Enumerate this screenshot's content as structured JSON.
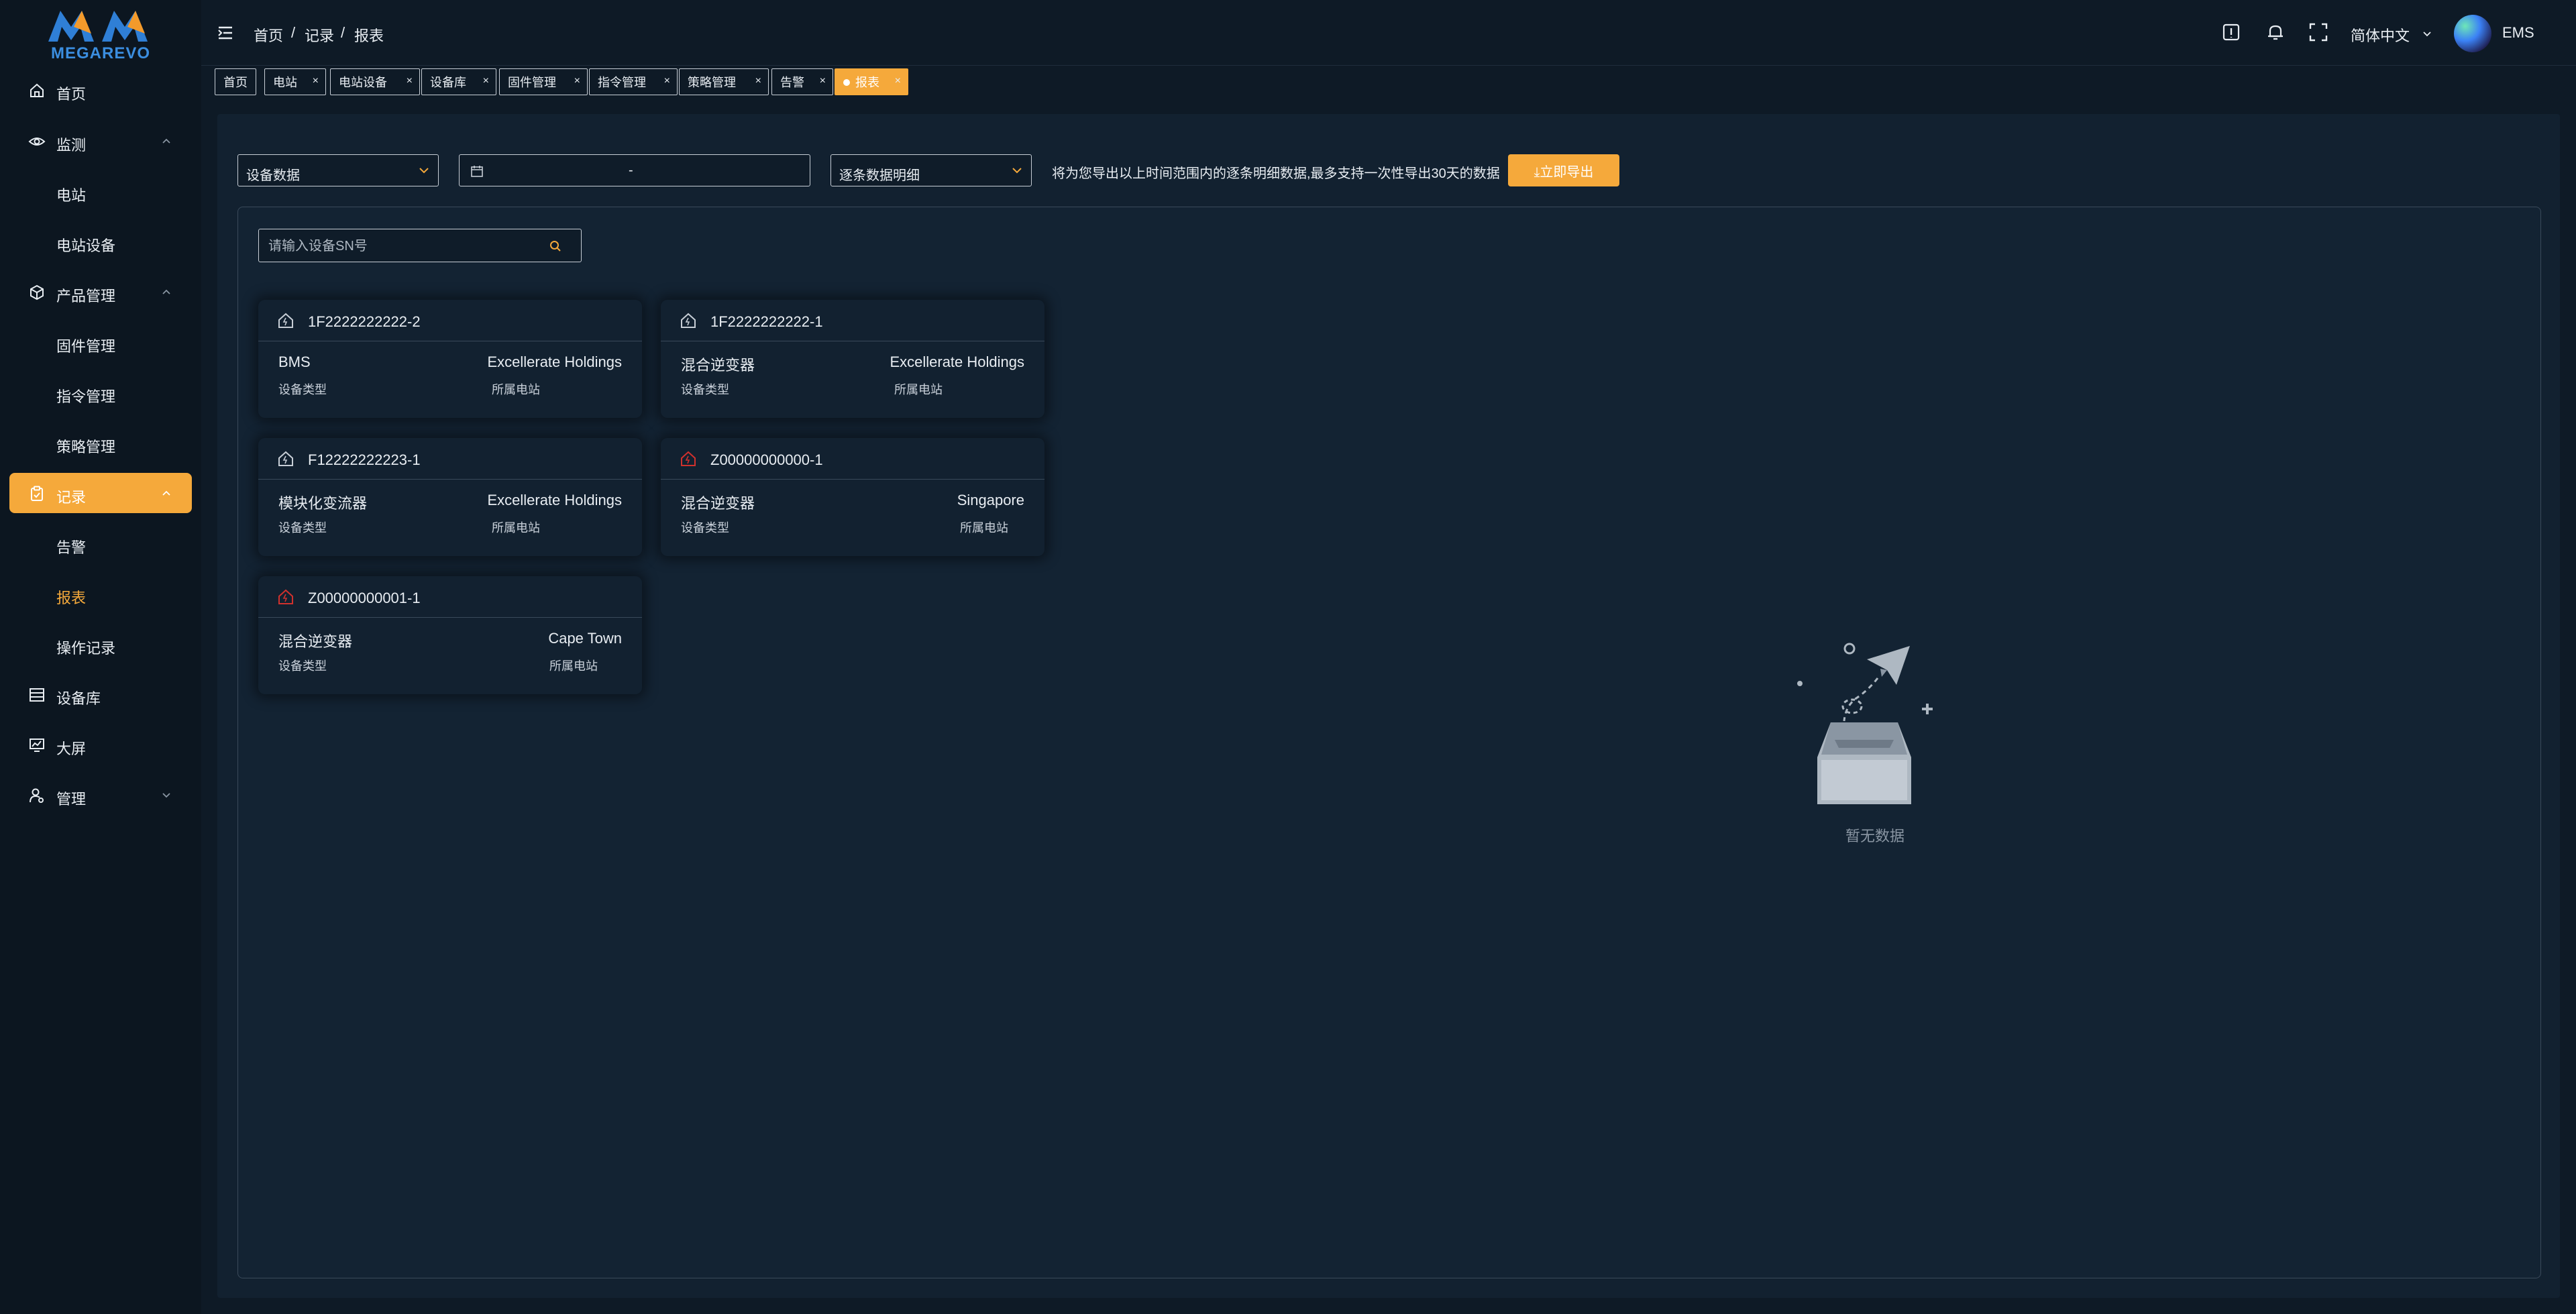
{
  "brand": {
    "name": "MEGAREVO"
  },
  "sidebar": {
    "items": [
      {
        "label": "首页",
        "icon": "home-icon"
      },
      {
        "label": "监测",
        "icon": "eye-icon",
        "expanded": true
      },
      {
        "label": "电站"
      },
      {
        "label": "电站设备"
      },
      {
        "label": "产品管理",
        "icon": "cube-icon",
        "expanded": true
      },
      {
        "label": "固件管理"
      },
      {
        "label": "指令管理"
      },
      {
        "label": "策略管理"
      },
      {
        "label": "记录",
        "icon": "clipboard-icon",
        "active": true
      },
      {
        "label": "告警"
      },
      {
        "label": "报表",
        "current": true
      },
      {
        "label": "操作记录"
      },
      {
        "label": "设备库",
        "icon": "list-icon"
      },
      {
        "label": "大屏",
        "icon": "screen-icon"
      },
      {
        "label": "管理",
        "icon": "user-gear-icon",
        "expanded": false
      }
    ]
  },
  "header": {
    "breadcrumb": [
      "首页",
      "/",
      "记录",
      "/",
      "报表"
    ],
    "language": "简体中文",
    "user": "EMS"
  },
  "tabs": [
    {
      "label": "首页",
      "closable": false
    },
    {
      "label": "电站",
      "closable": true
    },
    {
      "label": "电站设备",
      "closable": true
    },
    {
      "label": "设备库",
      "closable": true
    },
    {
      "label": "固件管理",
      "closable": true
    },
    {
      "label": "指令管理",
      "closable": true
    },
    {
      "label": "策略管理",
      "closable": true
    },
    {
      "label": "告警",
      "closable": true
    },
    {
      "label": "报表",
      "closable": true,
      "active": true
    }
  ],
  "toolbar": {
    "data_type": "设备数据",
    "date_separator": "-",
    "detail_type": "逐条数据明细",
    "hint": "将为您导出以上时间范围内的逐条明细数据,最多支持一次性导出30天的数据",
    "export_label": "⤓立即导出"
  },
  "search": {
    "placeholder": "请输入设备SN号"
  },
  "devices": [
    {
      "sn": "1F2222222222-2",
      "type": "BMS",
      "station": "Excellerate Holdings",
      "type_label": "设备类型",
      "station_label": "所属电站",
      "status": "normal"
    },
    {
      "sn": "1F2222222222-1",
      "type": "混合逆变器",
      "station": "Excellerate Holdings",
      "type_label": "设备类型",
      "station_label": "所属电站",
      "status": "normal"
    },
    {
      "sn": "F12222222223-1",
      "type": "模块化变流器",
      "station": "Excellerate Holdings",
      "type_label": "设备类型",
      "station_label": "所属电站",
      "status": "normal"
    },
    {
      "sn": "Z00000000000-1",
      "type": "混合逆变器",
      "station": "Singapore",
      "type_label": "设备类型",
      "station_label": "所属电站",
      "status": "alarm"
    },
    {
      "sn": "Z00000000001-1",
      "type": "混合逆变器",
      "station": "Cape Town",
      "type_label": "设备类型",
      "station_label": "所属电站",
      "status": "alarm"
    }
  ],
  "empty": {
    "text": "暂无数据"
  },
  "colors": {
    "accent": "#f5a93b",
    "background": "#0e1a26",
    "panel": "#122130",
    "alarm": "#d0312d",
    "brand_blue": "#3b8ee0"
  }
}
